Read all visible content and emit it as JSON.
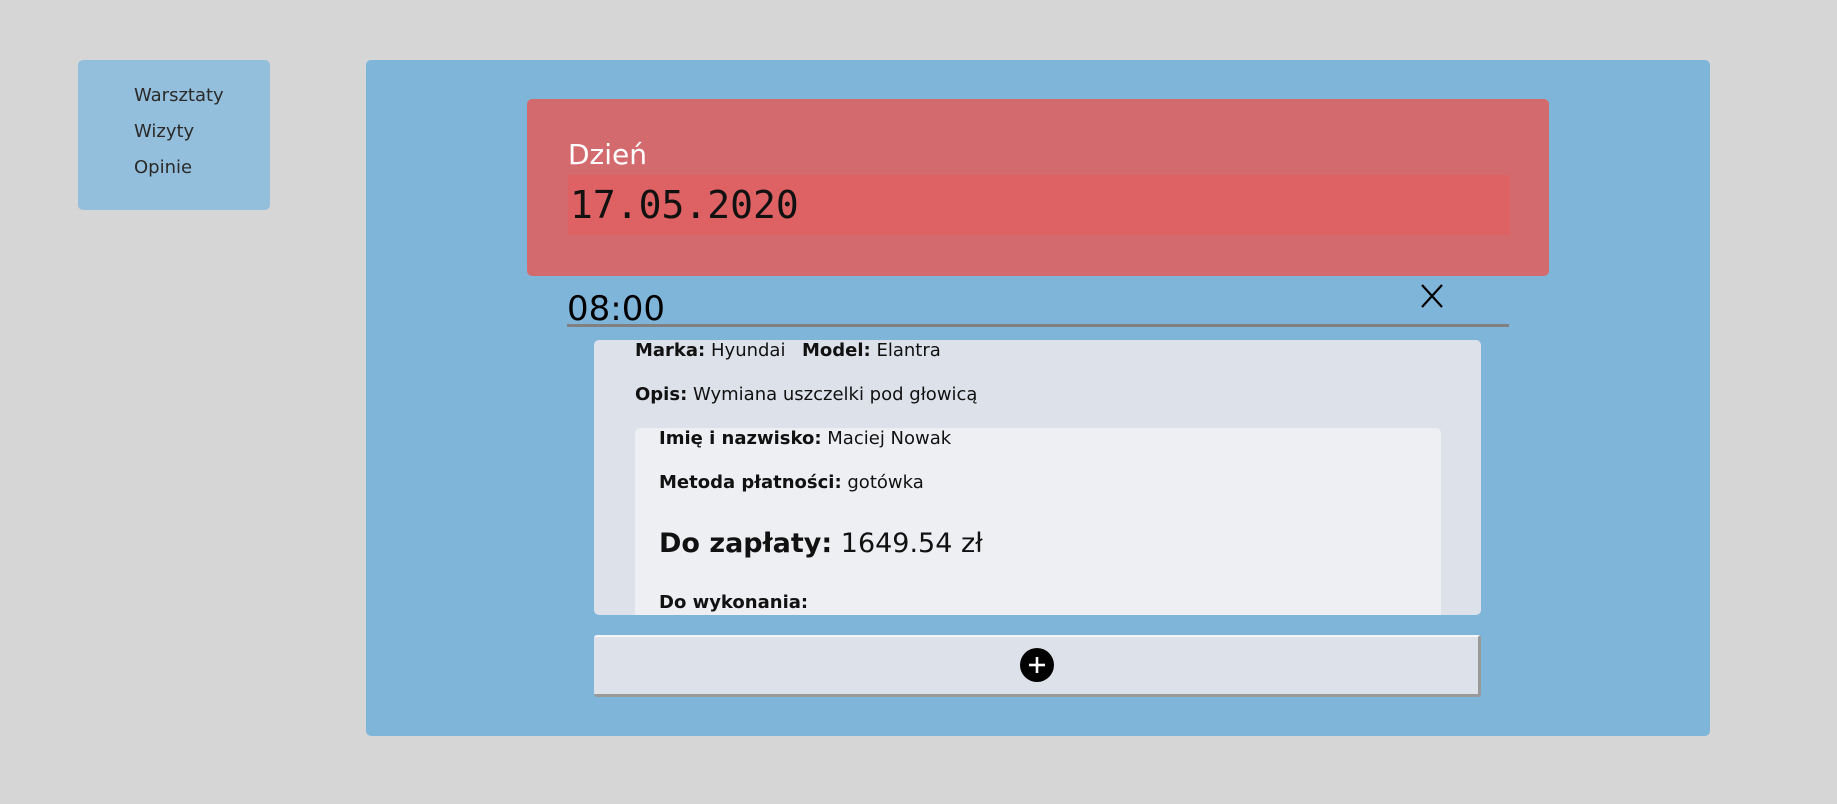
{
  "sidebar": {
    "items": [
      {
        "label": "Warsztaty"
      },
      {
        "label": "Wizyty"
      },
      {
        "label": "Opinie"
      }
    ]
  },
  "day_card": {
    "label": "Dzień",
    "date_value": "17.05.2020"
  },
  "time_row": {
    "time": "08:00",
    "close_icon": "close-icon"
  },
  "visit": {
    "brand_label": "Marka:",
    "brand_value": "Hyundai",
    "model_label": "Model:",
    "model_value": "Elantra",
    "description_label": "Opis:",
    "description_value": "Wymiana uszczelki pod głowicą",
    "client": {
      "name_label": "Imię i nazwisko:",
      "name_value": "Maciej Nowak",
      "payment_label": "Metoda płatności:",
      "payment_value": "gotówka",
      "total_label": "Do zapłaty:",
      "total_value": "1649.54 zł",
      "todo_label": "Do wykonania:"
    }
  },
  "add_button": {
    "icon": "plus-circle-icon"
  },
  "colors": {
    "page_bg": "#d6d6d6",
    "sidebar_bg": "#94bfdc",
    "main_bg": "#80b5da",
    "day_card_bg": "#d36b6e",
    "day_input_bg": "#de6263",
    "visit_card_bg": "#dde1e9",
    "client_card_bg": "#eeeff2"
  }
}
